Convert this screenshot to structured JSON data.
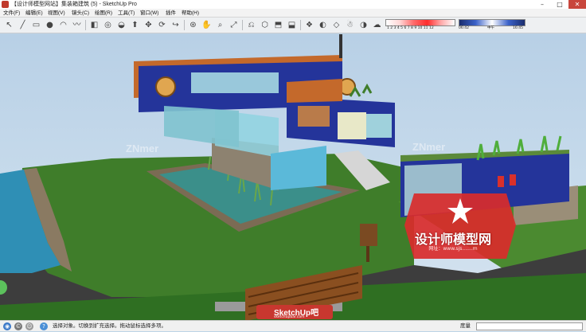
{
  "window": {
    "title": "【设计师模型网站】集装箱建筑 (5) - SketchUp Pro",
    "controls": [
      "minimize",
      "maximize",
      "close"
    ]
  },
  "menu": {
    "items": [
      "文件(F)",
      "编辑(E)",
      "视图(V)",
      "镜头(C)",
      "绘图(R)",
      "工具(T)",
      "窗口(W)",
      "插件",
      "帮助(H)"
    ]
  },
  "toolbar": {
    "tools": [
      {
        "name": "select-icon",
        "glyph": "↖"
      },
      {
        "name": "line-icon",
        "glyph": "╱"
      },
      {
        "name": "rectangle-icon",
        "glyph": "▭"
      },
      {
        "name": "circle-icon",
        "glyph": "●"
      },
      {
        "name": "arc-icon",
        "glyph": "◠"
      },
      {
        "name": "freehand-icon",
        "glyph": "〰"
      },
      {
        "name": "eraser-icon",
        "glyph": "◧"
      },
      {
        "name": "tape-icon",
        "glyph": "◎"
      },
      {
        "name": "paint-bucket-icon",
        "glyph": "◒"
      },
      {
        "name": "push-pull-icon",
        "glyph": "⬆"
      },
      {
        "name": "move-icon",
        "glyph": "✥"
      },
      {
        "name": "rotate-icon",
        "glyph": "⟳"
      },
      {
        "name": "follow-me-icon",
        "glyph": "↪"
      },
      {
        "name": "orbit-icon",
        "glyph": "⊛"
      },
      {
        "name": "pan-icon",
        "glyph": "✋"
      },
      {
        "name": "zoom-icon",
        "glyph": "⌕"
      },
      {
        "name": "zoom-extents-icon",
        "glyph": "⤢"
      },
      {
        "name": "previous-view-icon",
        "glyph": "⎌"
      },
      {
        "name": "iso-view-icon",
        "glyph": "⬡"
      },
      {
        "name": "top-view-icon",
        "glyph": "⬒"
      },
      {
        "name": "front-view-icon",
        "glyph": "⬓"
      },
      {
        "name": "components-icon",
        "glyph": "❖"
      },
      {
        "name": "materials-icon",
        "glyph": "◐"
      },
      {
        "name": "section-plane-icon",
        "glyph": "◇"
      },
      {
        "name": "walk-icon",
        "glyph": "☃"
      },
      {
        "name": "shadows-icon",
        "glyph": "◑"
      },
      {
        "name": "fog-icon",
        "glyph": "☁"
      }
    ],
    "shadow_months": "1 2 3 4 5 6 7 8 9 10 11 12",
    "shadow_time_start": "06:42",
    "shadow_noon": "中午",
    "shadow_time_end": "16:45"
  },
  "viewport": {
    "watermarks": [
      "ZNmer",
      "ZNmer"
    ],
    "logo": {
      "title": "设计师模型网",
      "subtitle": "网址：www.sjs.......m"
    },
    "sketchup_logo": {
      "text": "SketchUp吧",
      "site": "sketchupbar.com"
    },
    "colors": {
      "grass": "#3f7d2a",
      "water": "#2f8fb5",
      "container_blue": "#24349a",
      "roof_wood": "#c4692b",
      "logo_red": "#d92b2b"
    }
  },
  "status": {
    "text": "选择对象。切换到扩充选择。拖动鼠标选择多项。",
    "measure_label": "度量",
    "measure_value": ""
  }
}
